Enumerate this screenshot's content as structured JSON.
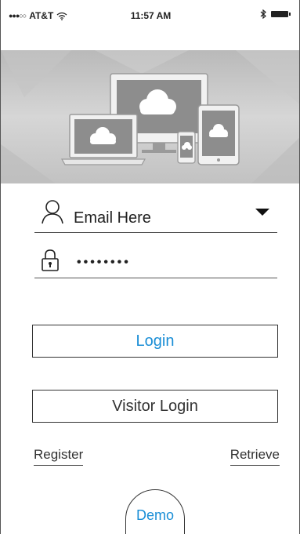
{
  "status_bar": {
    "signal_icon": "signal-dots-icon",
    "carrier": "AT&T",
    "wifi_icon": "wifi-icon",
    "time": "11:57 AM",
    "bluetooth_icon": "bluetooth-icon",
    "battery_icon": "battery-icon"
  },
  "hero": {
    "illustration": "cloud-devices-illustration"
  },
  "form": {
    "email_icon": "user-icon",
    "email_value": "Email Here",
    "dropdown_icon": "caret-down-icon",
    "password_icon": "lock-icon",
    "password_value": "••••••••"
  },
  "buttons": {
    "login": "Login",
    "visitor_login": "Visitor Login"
  },
  "links": {
    "register": "Register",
    "retrieve": "Retrieve"
  },
  "demo": {
    "label": "Demo"
  },
  "colors": {
    "accent": "#1a8ed6",
    "text": "#333333",
    "hero_bg": "#c8c8c8"
  }
}
